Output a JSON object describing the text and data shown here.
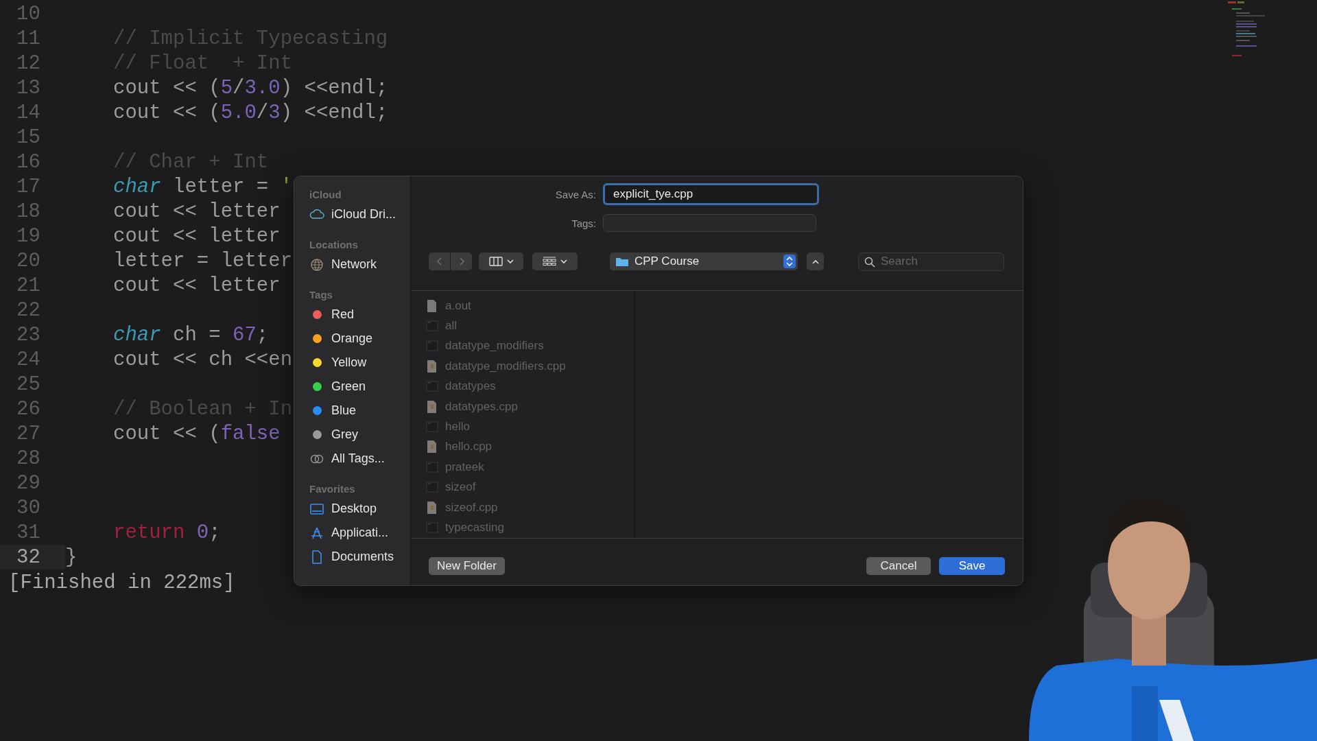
{
  "editor": {
    "lines": [
      {
        "number": "10"
      },
      {
        "number": "11",
        "indented": true,
        "tokens": [
          {
            "text": "// Implicit Typecasting",
            "kind": "comment"
          }
        ]
      },
      {
        "number": "12",
        "indented": true,
        "tokens": [
          {
            "text": "// Float  + Int",
            "kind": "comment"
          }
        ]
      },
      {
        "number": "13",
        "indented": true,
        "tokens": [
          {
            "text": "cout << (",
            "kind": "plain"
          },
          {
            "text": "5",
            "kind": "number"
          },
          {
            "text": "/",
            "kind": "plain"
          },
          {
            "text": "3.0",
            "kind": "number"
          },
          {
            "text": ") <<endl;",
            "kind": "plain"
          }
        ]
      },
      {
        "number": "14",
        "indented": true,
        "tokens": [
          {
            "text": "cout << (",
            "kind": "plain"
          },
          {
            "text": "5.0",
            "kind": "number"
          },
          {
            "text": "/",
            "kind": "plain"
          },
          {
            "text": "3",
            "kind": "number"
          },
          {
            "text": ") <<endl;",
            "kind": "plain"
          }
        ]
      },
      {
        "number": "15"
      },
      {
        "number": "16",
        "indented": true,
        "tokens": [
          {
            "text": "// Char + Int",
            "kind": "comment"
          }
        ]
      },
      {
        "number": "17",
        "indented": true,
        "tokens": [
          {
            "text": "char",
            "kind": "type"
          },
          {
            "text": " letter = ",
            "kind": "plain"
          },
          {
            "text": "'",
            "kind": "string"
          }
        ]
      },
      {
        "number": "18",
        "indented": true,
        "tokens": [
          {
            "text": "cout << letter",
            "kind": "plain"
          }
        ]
      },
      {
        "number": "19",
        "indented": true,
        "tokens": [
          {
            "text": "cout << letter",
            "kind": "plain"
          }
        ]
      },
      {
        "number": "20",
        "indented": true,
        "tokens": [
          {
            "text": "letter = letter",
            "kind": "plain"
          }
        ]
      },
      {
        "number": "21",
        "indented": true,
        "tokens": [
          {
            "text": "cout << letter",
            "kind": "plain"
          }
        ]
      },
      {
        "number": "22"
      },
      {
        "number": "23",
        "indented": true,
        "tokens": [
          {
            "text": "char",
            "kind": "type"
          },
          {
            "text": " ch = ",
            "kind": "plain"
          },
          {
            "text": "67",
            "kind": "number"
          },
          {
            "text": ";",
            "kind": "plain"
          }
        ]
      },
      {
        "number": "24",
        "indented": true,
        "tokens": [
          {
            "text": "cout << ch <<en",
            "kind": "plain"
          }
        ]
      },
      {
        "number": "25"
      },
      {
        "number": "26",
        "indented": true,
        "tokens": [
          {
            "text": "// Boolean + In",
            "kind": "comment"
          }
        ]
      },
      {
        "number": "27",
        "indented": true,
        "tokens": [
          {
            "text": "cout << (",
            "kind": "plain"
          },
          {
            "text": "false",
            "kind": "number"
          }
        ]
      },
      {
        "number": "28"
      },
      {
        "number": "29"
      },
      {
        "number": "30"
      },
      {
        "number": "31",
        "indented": true,
        "tokens": [
          {
            "text": "return",
            "kind": "keyword"
          },
          {
            "text": " 0",
            "kind": "number"
          },
          {
            "text": ";",
            "kind": "plain"
          }
        ]
      },
      {
        "number": "32",
        "current": true,
        "tokens": [
          {
            "text": "}",
            "kind": "plain"
          }
        ]
      }
    ],
    "output": "[Finished in 222ms]"
  },
  "dialog": {
    "sidebar": [
      {
        "heading": "iCloud",
        "items": [
          {
            "label": "iCloud Dri...",
            "kind": "cloud"
          }
        ]
      },
      {
        "heading": "Locations",
        "items": [
          {
            "label": "Network",
            "kind": "network"
          }
        ]
      },
      {
        "heading": "Tags",
        "items": [
          {
            "label": "Red",
            "kind": "tag",
            "color": "#f25b5b"
          },
          {
            "label": "Orange",
            "kind": "tag",
            "color": "#f9a125"
          },
          {
            "label": "Yellow",
            "kind": "tag",
            "color": "#fbd82a"
          },
          {
            "label": "Green",
            "kind": "tag",
            "color": "#35d14a"
          },
          {
            "label": "Blue",
            "kind": "tag",
            "color": "#2a8cf6"
          },
          {
            "label": "Grey",
            "kind": "tag",
            "color": "#9a9a9c"
          },
          {
            "label": "All Tags...",
            "kind": "all-tags"
          }
        ]
      },
      {
        "heading": "Favorites",
        "items": [
          {
            "label": "Desktop",
            "kind": "desktop"
          },
          {
            "label": "Applicati...",
            "kind": "applications"
          },
          {
            "label": "Documents",
            "kind": "documents"
          }
        ]
      }
    ],
    "save_as": {
      "label": "Save As:",
      "value": "explicit_tye.cpp"
    },
    "tags": {
      "label": "Tags:"
    },
    "location": "CPP Course",
    "search": {
      "placeholder": "Search"
    },
    "files": [
      {
        "name": "a.out",
        "kind": "plain",
        "disabled": true
      },
      {
        "name": "all",
        "kind": "executable",
        "disabled": true
      },
      {
        "name": "datatype_modifiers",
        "kind": "executable",
        "disabled": true
      },
      {
        "name": "datatype_modifiers.cpp",
        "kind": "source",
        "disabled": true
      },
      {
        "name": "datatypes",
        "kind": "executable",
        "disabled": true
      },
      {
        "name": "datatypes.cpp",
        "kind": "source",
        "disabled": true
      },
      {
        "name": "hello",
        "kind": "executable",
        "disabled": true
      },
      {
        "name": "hello.cpp",
        "kind": "source",
        "disabled": true
      },
      {
        "name": "prateek",
        "kind": "executable",
        "disabled": true
      },
      {
        "name": "sizeof",
        "kind": "executable",
        "disabled": true
      },
      {
        "name": "sizeof.cpp",
        "kind": "source",
        "disabled": true
      },
      {
        "name": "typecasting",
        "kind": "executable",
        "disabled": true
      }
    ],
    "left_buttons": [
      {
        "label": "New Folder",
        "default": false
      }
    ],
    "right_buttons": [
      {
        "label": "Cancel",
        "default": false
      },
      {
        "label": "Save",
        "default": true
      }
    ]
  }
}
